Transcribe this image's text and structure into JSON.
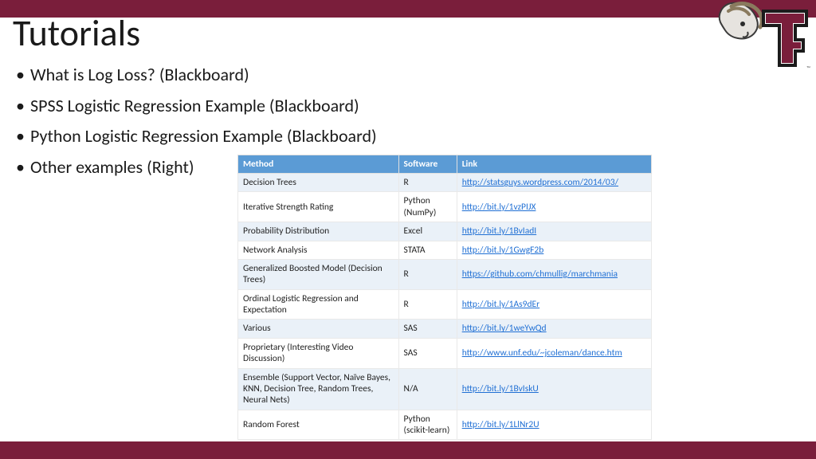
{
  "colors": {
    "brand": "#7a1e3b",
    "table_header": "#5b9bd5",
    "link": "#1f6fd4"
  },
  "title": "Tutorials",
  "bullets": [
    "What is Log Loss? (Blackboard)",
    "SPSS Logistic Regression Example (Blackboard)",
    "Python Logistic Regression Example (Blackboard)",
    "Other examples (Right)"
  ],
  "table": {
    "headers": {
      "method": "Method",
      "software": "Software",
      "link": "Link"
    },
    "rows": [
      {
        "method": "Decision Trees",
        "software": "R",
        "link": "http://statsguys.wordpress.com/2014/03/"
      },
      {
        "method": "Iterative Strength Rating",
        "software": "Python (NumPy)",
        "link": "http://bit.ly/1vzPIJX"
      },
      {
        "method": "Probability Distribution",
        "software": "Excel",
        "link": "http://bit.ly/1BvIadI"
      },
      {
        "method": "Network Analysis",
        "software": "STATA",
        "link": "http://bit.ly/1GwgF2b"
      },
      {
        "method": "Generalized Boosted Model (Decision Trees)",
        "software": "R",
        "link": "https://github.com/chmullig/marchmania"
      },
      {
        "method": "Ordinal Logistic Regression and Expectation",
        "software": "R",
        "link": "http://bit.ly/1As9dEr"
      },
      {
        "method": "Various",
        "software": "SAS",
        "link": "http://bit.ly/1weYwQd"
      },
      {
        "method": "Proprietary (Interesting Video Discussion)",
        "software": "SAS",
        "link": "http://www.unf.edu/~jcoleman/dance.htm"
      },
      {
        "method": "Ensemble (Support Vector, Naïve Bayes, KNN, Decision Tree, Random Trees, Neural Nets)",
        "software": "N/A",
        "link": "http://bit.ly/1BvIskU"
      },
      {
        "method": "Random Forest",
        "software": "Python (scikit-learn)",
        "link": "http://bit.ly/1LlNr2U"
      }
    ]
  }
}
